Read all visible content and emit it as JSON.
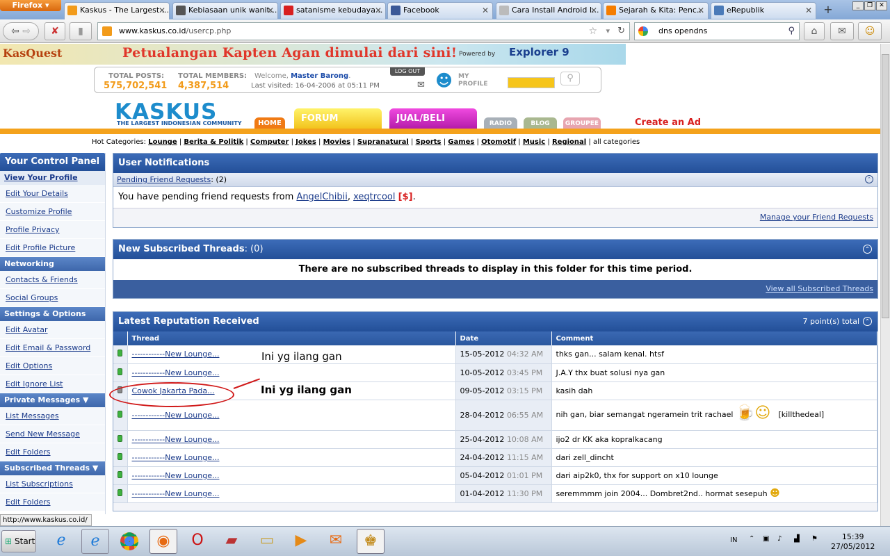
{
  "browser": {
    "menu_button": "Firefox",
    "tabs": [
      {
        "label": "Kaskus - The Largest ...",
        "color": "#f29b1a",
        "active": true
      },
      {
        "label": "Kebiasaan unik wanit...",
        "color": "#555555",
        "active": false
      },
      {
        "label": "satanisme kebudaya...",
        "color": "#d81f1f",
        "active": false
      },
      {
        "label": "Facebook",
        "color": "#3b5998",
        "active": false
      },
      {
        "label": "Cara Install Android I...",
        "color": "#bbbbbb",
        "active": false
      },
      {
        "label": "Sejarah & Kita: Penc...",
        "color": "#f57d00",
        "active": false
      },
      {
        "label": "eRepublik",
        "color": "#4a7ab8",
        "active": false
      }
    ],
    "url_host": "www.kaskus.co.id",
    "url_path": "/usercp.php",
    "search_value": "dns opendns",
    "status_url": "http://www.kaskus.co.id/"
  },
  "banner": {
    "logo_text": "KasQuest",
    "title": "Petualangan Kapten Agan dimulai dari sini!",
    "powered": "Powered by",
    "ie": "Explorer 9"
  },
  "stats": {
    "total_posts_label": "TOTAL POSTS:",
    "total_posts": "575,702,541",
    "total_members_label": "TOTAL MEMBERS:",
    "total_members": "4,387,514",
    "welcome_prefix": "Welcome,",
    "username": "Master Barong",
    "last_visited": "Last visited: 16-04-2006 at 05:11 PM",
    "logout": "LOG OUT",
    "my_profile": "MY PROFILE"
  },
  "site": {
    "logo": "KASKUS",
    "tagline": "THE LARGEST INDONESIAN COMMUNITY",
    "nav": {
      "home": "HOME",
      "forum": "FORUM",
      "jualbeli": "JUAL/BELI",
      "radio": "RADIO",
      "blog": "BLOG",
      "groupee": "GROUPEE"
    },
    "create_ad": "Create an Ad",
    "hot_label": "Hot Categories:",
    "hot_categories": [
      "Lounge",
      "Berita & Politik",
      "Computer",
      "Jokes",
      "Movies",
      "Supranatural",
      "Sports",
      "Games",
      "Otomotif",
      "Music",
      "Regional"
    ],
    "all_categories": "all categories"
  },
  "sidebar": {
    "title": "Your Control Panel",
    "current": "View Your Profile",
    "groups": [
      {
        "items": [
          "Edit Your Details",
          "Customize Profile",
          "Profile Privacy",
          "Edit Profile Picture"
        ]
      },
      {
        "title": "Networking",
        "items": [
          "Contacts & Friends",
          "Social Groups"
        ]
      },
      {
        "title": "Settings & Options",
        "items": [
          "Edit Avatar",
          "Edit Email & Password",
          "Edit Options",
          "Edit Ignore List"
        ]
      },
      {
        "title": "Private Messages ▼",
        "items": [
          "List Messages",
          "Send New Message",
          "Edit Folders"
        ]
      },
      {
        "title": "Subscribed Threads ▼",
        "items": [
          "List Subscriptions",
          "Edit Folders"
        ]
      }
    ]
  },
  "notifications": {
    "title": "User Notifications",
    "pending_label": "Pending Friend Requests",
    "pending_count": ": (2)",
    "message_prefix": "You have pending friend requests from",
    "friend1": "AngelChibii",
    "sep": ",",
    "friend2": "xeqtrcool",
    "dollar": "[$]",
    "manage_link": "Manage your Friend Requests"
  },
  "subscribed": {
    "title": "New Subscribed Threads",
    "count": ": (0)",
    "empty_message": "There are no subscribed threads to display in this folder for this time period.",
    "view_all": "View all Subscribed Threads"
  },
  "reputation": {
    "title": "Latest Reputation Received",
    "total": "7 point(s) total",
    "columns": [
      "Thread",
      "Date",
      "Comment"
    ],
    "rows": [
      {
        "thread": "------------New Lounge...",
        "date": "15-05-2012",
        "time": "04:32 AM",
        "comment": "thks gan... salam kenal. htsf",
        "dot": "green"
      },
      {
        "thread": "------------New Lounge...",
        "date": "10-05-2012",
        "time": "03:45 PM",
        "comment": "J.A.Y thx buat solusi nya gan",
        "dot": "green"
      },
      {
        "thread": "Cowok Jakarta Pada...",
        "date": "09-05-2012",
        "time": "03:15 PM",
        "comment": "kasih dah",
        "dot": "grey"
      },
      {
        "thread": "------------New Lounge...",
        "date": "28-04-2012",
        "time": "06:55 AM",
        "comment": "nih gan, biar semangat ngeramein trit rachael",
        "extra": "[killthedeal]",
        "dot": "green"
      },
      {
        "thread": "------------New Lounge...",
        "date": "25-04-2012",
        "time": "10:08 AM",
        "comment": "ijo2 dr KK aka kopralkacang",
        "dot": "green"
      },
      {
        "thread": "------------New Lounge...",
        "date": "24-04-2012",
        "time": "11:15 AM",
        "comment": "dari zell_dincht",
        "dot": "green"
      },
      {
        "thread": "------------New Lounge...",
        "date": "05-04-2012",
        "time": "01:01 PM",
        "comment": "dari aip2k0, thx for support on x10 lounge",
        "dot": "green"
      },
      {
        "thread": "------------New Lounge...",
        "date": "01-04-2012",
        "time": "11:30 PM",
        "comment": "seremmmm join 2004... Dombret2nd.. hormat sesepuh",
        "dot": "green"
      }
    ]
  },
  "annotations": {
    "note1": "Ini yg ilang gan",
    "note2": "Ini yg ilang gan"
  },
  "taskbar": {
    "start": "Start",
    "lang": "IN",
    "time": "15:39",
    "date": "27/05/2012"
  }
}
